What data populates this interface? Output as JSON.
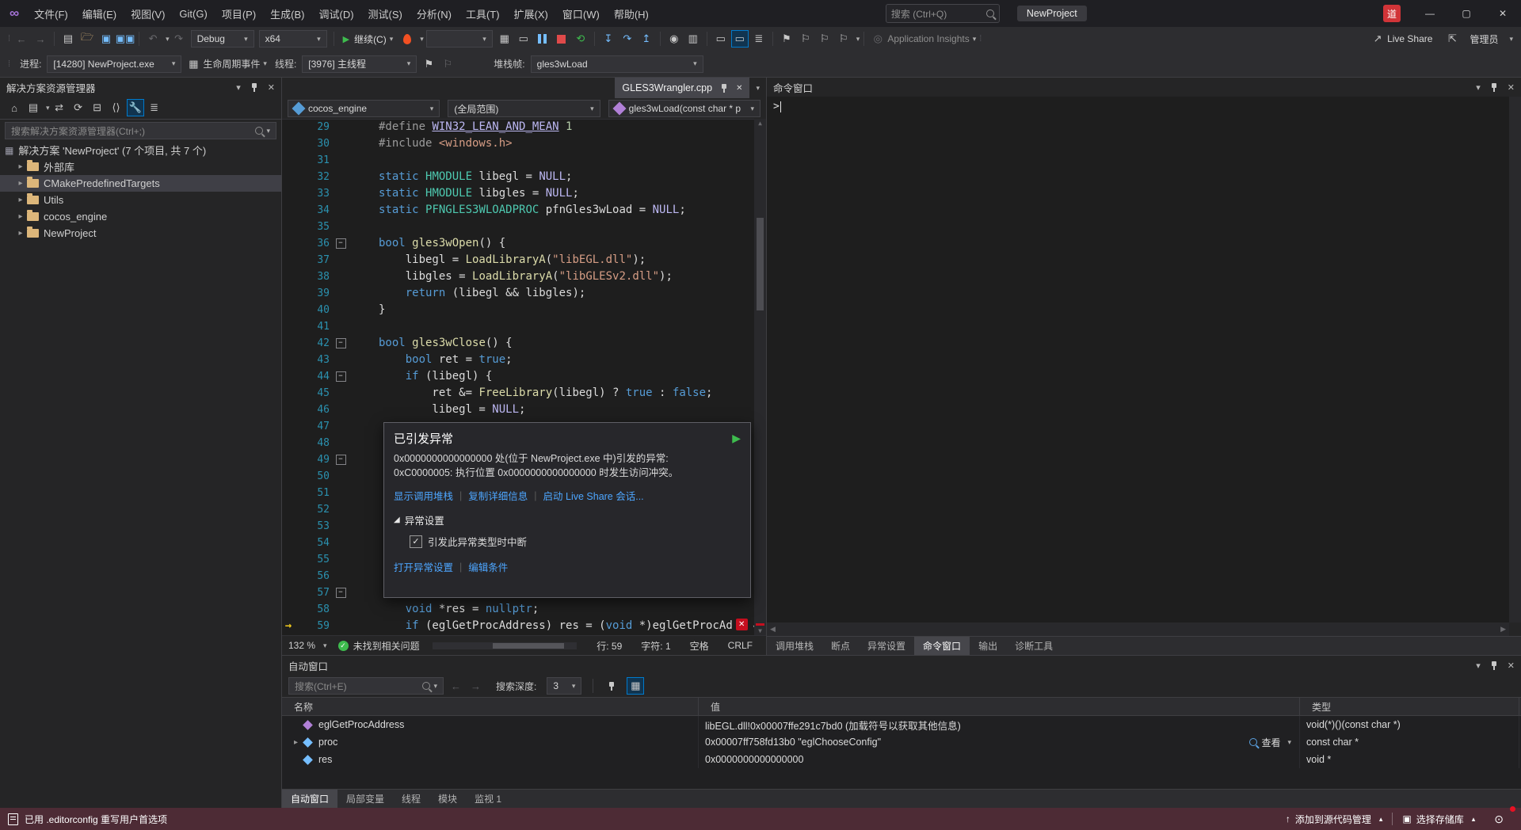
{
  "window": {
    "title": "NewProject",
    "search_placeholder": "搜索 (Ctrl+Q)",
    "user_badge": "道"
  },
  "menu": {
    "items": [
      "文件(F)",
      "编辑(E)",
      "视图(V)",
      "Git(G)",
      "项目(P)",
      "生成(B)",
      "调试(D)",
      "测试(S)",
      "分析(N)",
      "工具(T)",
      "扩展(X)",
      "窗口(W)",
      "帮助(H)"
    ]
  },
  "toolbar": {
    "config": "Debug",
    "platform": "x64",
    "continue_label": "继续(C)",
    "app_insights": "Application Insights",
    "live_share": "Live Share",
    "admin": "管理员"
  },
  "debug_location": {
    "process_label": "进程:",
    "process": "[14280] NewProject.exe",
    "lifecycle": "生命周期事件",
    "thread_label": "线程:",
    "thread": "[3976] 主线程",
    "frame_label": "堆栈帧:",
    "frame": "gles3wLoad"
  },
  "solution_explorer": {
    "title": "解决方案资源管理器",
    "search_placeholder": "搜索解决方案资源管理器(Ctrl+;)",
    "root": "解决方案 'NewProject' (7 个项目, 共 7 个)",
    "items": [
      {
        "label": "外部库",
        "selected": false
      },
      {
        "label": "CMakePredefinedTargets",
        "selected": true
      },
      {
        "label": "Utils",
        "selected": false
      },
      {
        "label": "cocos_engine",
        "selected": false
      },
      {
        "label": "NewProject",
        "selected": false
      }
    ]
  },
  "editor": {
    "tab": "GLES3Wrangler.cpp",
    "nav": {
      "project": "cocos_engine",
      "scope": "(全局范围)",
      "member": "gles3wLoad(const char * p"
    },
    "zoom": "132 %",
    "health": "未找到相关问题",
    "status": {
      "line": "行: 59",
      "char": "字符: 1",
      "spaces": "空格",
      "eol": "CRLF"
    },
    "code": [
      {
        "n": 29,
        "t": [
          [
            "d",
            "#define "
          ],
          [
            "mu",
            "WIN32_LEAN_AND_MEAN"
          ],
          [
            "p",
            " "
          ],
          [
            "num",
            "1"
          ]
        ]
      },
      {
        "n": 30,
        "t": [
          [
            "d",
            "#include "
          ],
          [
            "s",
            "<windows.h>"
          ]
        ]
      },
      {
        "n": 31,
        "t": []
      },
      {
        "n": 32,
        "t": [
          [
            "k",
            "static "
          ],
          [
            "ty",
            "HMODULE"
          ],
          [
            "p",
            " libegl = "
          ],
          [
            "m",
            "NULL"
          ],
          [
            "p",
            ";"
          ]
        ]
      },
      {
        "n": 33,
        "t": [
          [
            "k",
            "static "
          ],
          [
            "ty",
            "HMODULE"
          ],
          [
            "p",
            " libgles = "
          ],
          [
            "m",
            "NULL"
          ],
          [
            "p",
            ";"
          ]
        ]
      },
      {
        "n": 34,
        "t": [
          [
            "k",
            "static "
          ],
          [
            "ty",
            "PFNGLES3WLOADPROC"
          ],
          [
            "p",
            " pfnGles3wLoad = "
          ],
          [
            "m",
            "NULL"
          ],
          [
            "p",
            ";"
          ]
        ]
      },
      {
        "n": 35,
        "t": []
      },
      {
        "n": 36,
        "fold": true,
        "t": [
          [
            "k",
            "bool"
          ],
          [
            "p",
            " "
          ],
          [
            "f",
            "gles3wOpen"
          ],
          [
            "p",
            "() {"
          ]
        ]
      },
      {
        "n": 37,
        "t": [
          [
            "p",
            "    libegl = "
          ],
          [
            "f",
            "LoadLibraryA"
          ],
          [
            "p",
            "("
          ],
          [
            "s",
            "\"libEGL.dll\""
          ],
          [
            "p",
            ");"
          ]
        ]
      },
      {
        "n": 38,
        "t": [
          [
            "p",
            "    libgles = "
          ],
          [
            "f",
            "LoadLibraryA"
          ],
          [
            "p",
            "("
          ],
          [
            "s",
            "\"libGLESv2.dll\""
          ],
          [
            "p",
            ");"
          ]
        ]
      },
      {
        "n": 39,
        "t": [
          [
            "p",
            "    "
          ],
          [
            "k",
            "return"
          ],
          [
            "p",
            " (libegl && libgles);"
          ]
        ]
      },
      {
        "n": 40,
        "t": [
          [
            "p",
            "}"
          ]
        ]
      },
      {
        "n": 41,
        "t": []
      },
      {
        "n": 42,
        "fold": true,
        "t": [
          [
            "k",
            "bool"
          ],
          [
            "p",
            " "
          ],
          [
            "f",
            "gles3wClose"
          ],
          [
            "p",
            "() {"
          ]
        ]
      },
      {
        "n": 43,
        "t": [
          [
            "p",
            "    "
          ],
          [
            "k",
            "bool"
          ],
          [
            "p",
            " ret = "
          ],
          [
            "k",
            "true"
          ],
          [
            "p",
            ";"
          ]
        ]
      },
      {
        "n": 44,
        "fold": true,
        "t": [
          [
            "p",
            "    "
          ],
          [
            "k",
            "if"
          ],
          [
            "p",
            " (libegl) {"
          ]
        ]
      },
      {
        "n": 45,
        "t": [
          [
            "p",
            "        ret &= "
          ],
          [
            "f",
            "FreeLibrary"
          ],
          [
            "p",
            "(libegl) ? "
          ],
          [
            "k",
            "true"
          ],
          [
            "p",
            " : "
          ],
          [
            "k",
            "false"
          ],
          [
            "p",
            ";"
          ]
        ]
      },
      {
        "n": 46,
        "t": [
          [
            "p",
            "        libegl = "
          ],
          [
            "m",
            "NULL"
          ],
          [
            "p",
            ";"
          ]
        ]
      },
      {
        "n": 47,
        "t": []
      },
      {
        "n": 48,
        "t": []
      },
      {
        "n": 49,
        "fold": true,
        "t": []
      },
      {
        "n": 50,
        "t": []
      },
      {
        "n": 51,
        "t": []
      },
      {
        "n": 52,
        "t": []
      },
      {
        "n": 53,
        "t": []
      },
      {
        "n": 54,
        "t": []
      },
      {
        "n": 55,
        "t": []
      },
      {
        "n": 56,
        "t": []
      },
      {
        "n": 57,
        "fold": true,
        "t": []
      },
      {
        "n": 58,
        "t": [
          [
            "p",
            "    "
          ],
          [
            "k",
            "void"
          ],
          [
            "p",
            " *res = "
          ],
          [
            "k",
            "nullptr"
          ],
          [
            "p",
            ";"
          ]
        ]
      },
      {
        "n": 59,
        "cur": true,
        "exc": true,
        "t": [
          [
            "p",
            "    "
          ],
          [
            "k",
            "if"
          ],
          [
            "p",
            " (eglGetProcAddress) res = ("
          ],
          [
            "k",
            "void"
          ],
          [
            "p",
            " *)eglGetProcAd"
          ]
        ]
      }
    ]
  },
  "exception": {
    "title": "已引发异常",
    "line1": "0x0000000000000000 处(位于 NewProject.exe 中)引发的异常:",
    "line2": "0xC0000005: 执行位置 0x0000000000000000 时发生访问冲突。",
    "links1": [
      "显示调用堆栈",
      "复制详细信息",
      "启动 Live Share 会话..."
    ],
    "settings": "异常设置",
    "checkbox": "引发此异常类型时中断",
    "links2": [
      "打开异常设置",
      "编辑条件"
    ]
  },
  "command_window": {
    "title": "命令窗口",
    "prompt": ">",
    "tabs": [
      {
        "label": "调用堆栈",
        "active": false
      },
      {
        "label": "断点",
        "active": false
      },
      {
        "label": "异常设置",
        "active": false
      },
      {
        "label": "命令窗口",
        "active": true
      },
      {
        "label": "输出",
        "active": false
      },
      {
        "label": "诊断工具",
        "active": false
      }
    ]
  },
  "autos": {
    "title": "自动窗口",
    "search_placeholder": "搜索(Ctrl+E)",
    "depth_label": "搜索深度:",
    "depth": "3",
    "columns": [
      "名称",
      "值",
      "类型"
    ],
    "rows": [
      {
        "expand": false,
        "icon": "method",
        "name": "eglGetProcAddress",
        "value": "libEGL.dll!0x00007ffe291c7bd0 (加载符号以获取其他信息)",
        "type": "void(*)()(const char *)"
      },
      {
        "expand": true,
        "icon": "field",
        "name": "proc",
        "value": "0x00007ff758fd13b0 \"eglChooseConfig\"",
        "view": "查看",
        "type": "const char *"
      },
      {
        "expand": false,
        "icon": "field",
        "name": "res",
        "value": "0x0000000000000000",
        "type": "void *"
      }
    ],
    "tabs": [
      {
        "label": "自动窗口",
        "active": true
      },
      {
        "label": "局部变量",
        "active": false
      },
      {
        "label": "线程",
        "active": false
      },
      {
        "label": "模块",
        "active": false
      },
      {
        "label": "监视 1",
        "active": false
      }
    ]
  },
  "status_bar": {
    "left": "已用 .editorconfig 重写用户首选项",
    "add_source_control": "添加到源代码管理",
    "select_repo": "选择存储库"
  }
}
